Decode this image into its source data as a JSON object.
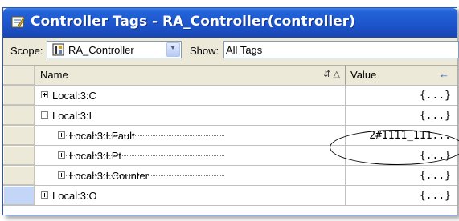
{
  "window": {
    "title": "Controller Tags - RA_Controller(controller)",
    "title_icon": "tag-editor-icon"
  },
  "scope": {
    "label": "Scope:",
    "value": "RA_Controller",
    "icon": "controller-icon"
  },
  "show": {
    "label": "Show:",
    "value": "All Tags"
  },
  "columns": {
    "name": "Name",
    "value": "Value",
    "sort_icons": "⇵ △",
    "pin_icon": "←"
  },
  "rows": [
    {
      "name": "Local:3:C",
      "value": "{...}",
      "expander": "plus",
      "indent": 0
    },
    {
      "name": "Local:3:I",
      "value": "{...}",
      "expander": "minus",
      "indent": 0
    },
    {
      "name": "Local:3:I.Fault",
      "value": "2#1111_111...",
      "expander": "plus",
      "indent": 1
    },
    {
      "name": "Local:3:I.Pt",
      "value": "{...}",
      "expander": "plus",
      "indent": 1
    },
    {
      "name": "Local:3:I.Counter",
      "value": "{...}",
      "expander": "plus",
      "indent": 1
    },
    {
      "name": "Local:3:O",
      "value": "{...}",
      "expander": "plus",
      "indent": 0
    }
  ],
  "colors": {
    "titlebar": "#2463d8",
    "window_bg": "#ece9d8",
    "selected_rowheader": "#c4d6f7"
  }
}
